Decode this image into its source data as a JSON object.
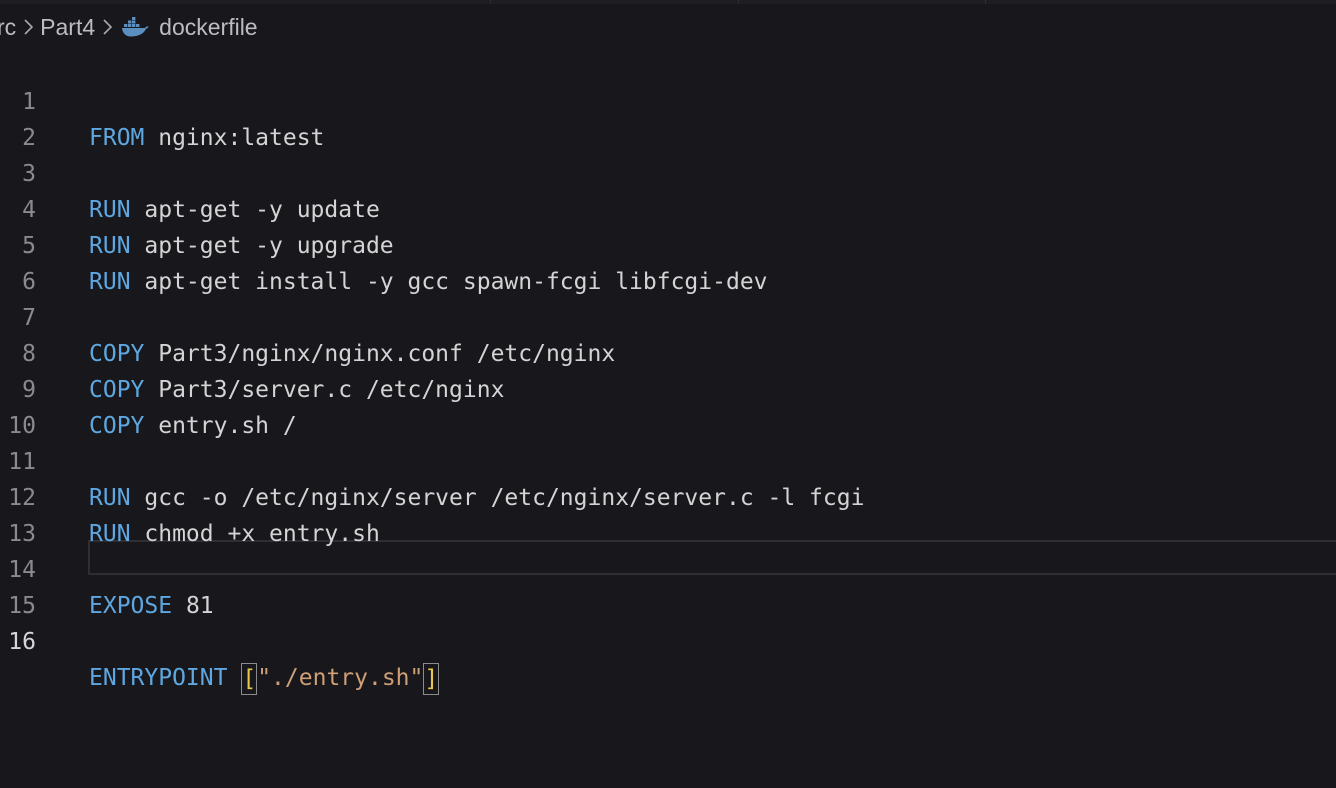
{
  "breadcrumb": {
    "items": [
      "rc",
      "Part4",
      "dockerfile"
    ],
    "file_icon": "docker-icon"
  },
  "editor": {
    "language": "dockerfile",
    "current_line": 16,
    "colors": {
      "background": "#18171c",
      "keyword": "#5ea7e0",
      "text": "#d4d4d4",
      "string": "#cf9f75",
      "bracket": "#e6c84a",
      "line_number": "#8a8a90"
    },
    "lines": [
      {
        "n": "1",
        "kw": "FROM",
        "rest": " nginx:latest"
      },
      {
        "n": "2",
        "kw": "",
        "rest": ""
      },
      {
        "n": "3",
        "kw": "RUN",
        "rest": " apt-get -y update"
      },
      {
        "n": "4",
        "kw": "RUN",
        "rest": " apt-get -y upgrade"
      },
      {
        "n": "5",
        "kw": "RUN",
        "rest": " apt-get install -y gcc spawn-fcgi libfcgi-dev"
      },
      {
        "n": "6",
        "kw": "",
        "rest": ""
      },
      {
        "n": "7",
        "kw": "COPY",
        "rest": " Part3/nginx/nginx.conf /etc/nginx"
      },
      {
        "n": "8",
        "kw": "COPY",
        "rest": " Part3/server.c /etc/nginx"
      },
      {
        "n": "9",
        "kw": "COPY",
        "rest": " entry.sh /"
      },
      {
        "n": "10",
        "kw": "",
        "rest": ""
      },
      {
        "n": "11",
        "kw": "RUN",
        "rest": " gcc -o /etc/nginx/server /etc/nginx/server.c -l fcgi"
      },
      {
        "n": "12",
        "kw": "RUN",
        "rest": " chmod +x entry.sh"
      },
      {
        "n": "13",
        "kw": "",
        "rest": ""
      },
      {
        "n": "14",
        "kw": "EXPOSE",
        "rest": " 81"
      },
      {
        "n": "15",
        "kw": "",
        "rest": ""
      },
      {
        "n": "16",
        "kw": "ENTRYPOINT",
        "rest": " ",
        "open_bracket": "[",
        "string": "\"./entry.sh\"",
        "close_bracket": "]"
      }
    ]
  }
}
